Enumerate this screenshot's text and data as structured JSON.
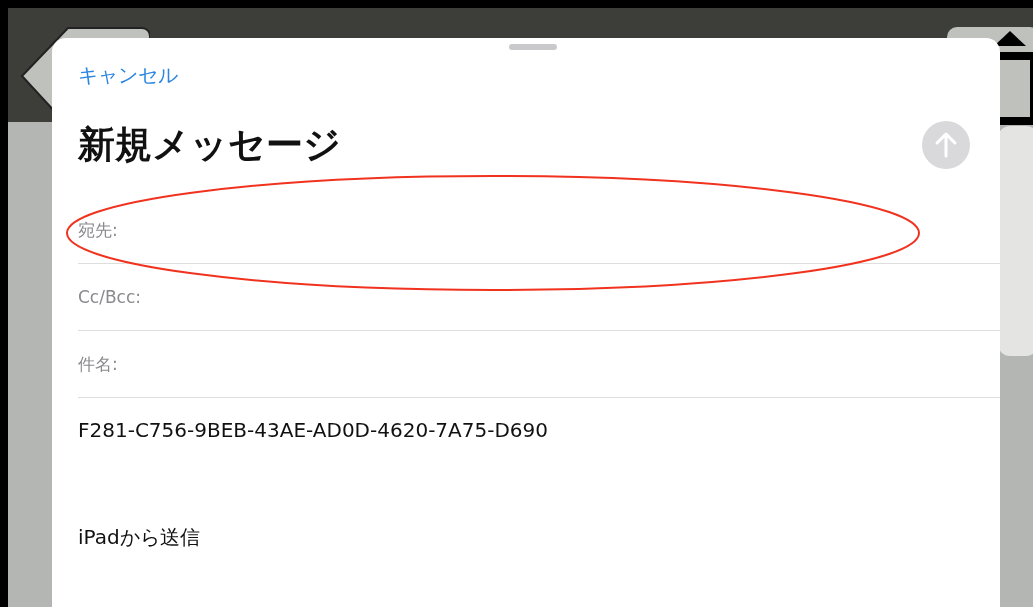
{
  "sheet": {
    "cancel": "キャンセル",
    "title": "新規メッセージ",
    "send_enabled": false,
    "fields": [
      {
        "label": "宛先:",
        "highlighted": true
      },
      {
        "label": "Cc/Bcc:",
        "highlighted": false
      },
      {
        "label": "件名:",
        "highlighted": false
      }
    ],
    "body": [
      "F281-C756-9BEB-43AE-AD0D-4620-7A75-D690",
      "iPadから送信"
    ]
  }
}
